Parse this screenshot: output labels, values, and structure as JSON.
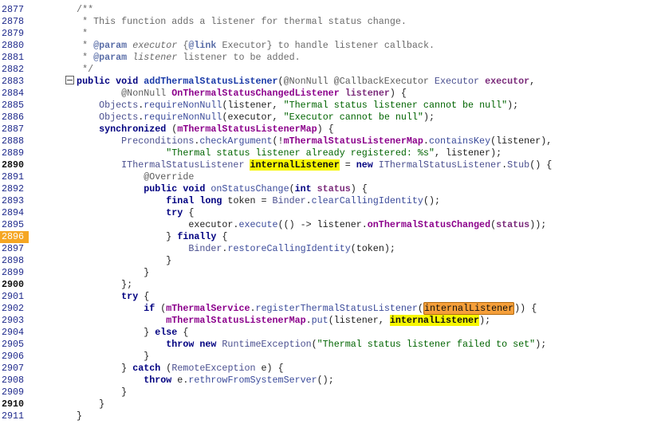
{
  "editor": {
    "highlighted_line": 2896,
    "lines": [
      {
        "num": "2877",
        "tokens": [
          {
            "t": "cm",
            "v": "    /**"
          }
        ]
      },
      {
        "num": "2878",
        "tokens": [
          {
            "t": "cm",
            "v": "     * This function adds a listener for thermal status change."
          }
        ]
      },
      {
        "num": "2879",
        "tokens": [
          {
            "t": "cm",
            "v": "     *"
          }
        ]
      },
      {
        "num": "2880",
        "tokens": [
          {
            "t": "cm",
            "v": "     * "
          },
          {
            "t": "ct",
            "v": "@param"
          },
          {
            "t": "cm",
            "v": " "
          },
          {
            "t": "ci",
            "v": "executor"
          },
          {
            "t": "cm",
            "v": " {"
          },
          {
            "t": "ct",
            "v": "@link"
          },
          {
            "t": "cm",
            "v": " Executor} to handle listener callback."
          }
        ]
      },
      {
        "num": "2881",
        "tokens": [
          {
            "t": "cm",
            "v": "     * "
          },
          {
            "t": "ct",
            "v": "@param"
          },
          {
            "t": "cm",
            "v": " "
          },
          {
            "t": "ci",
            "v": "listener"
          },
          {
            "t": "cm",
            "v": " listener to be added."
          }
        ]
      },
      {
        "num": "2882",
        "tokens": [
          {
            "t": "cm",
            "v": "     */"
          }
        ]
      },
      {
        "num": "2883",
        "tokens": [
          {
            "t": "kw",
            "v": "    public void "
          },
          {
            "t": "fn",
            "v": "addThermalStatusListener"
          },
          {
            "t": "pl",
            "v": "("
          },
          {
            "t": "an",
            "v": "@NonNull @CallbackExecutor"
          },
          {
            "t": "ty",
            "v": " Executor "
          },
          {
            "t": "pm",
            "v": "executor"
          },
          {
            "t": "pl",
            "v": ","
          }
        ]
      },
      {
        "num": "2884",
        "tokens": [
          {
            "t": "an",
            "v": "            @NonNull "
          },
          {
            "t": "fd",
            "v": "OnThermalStatusChangedListener"
          },
          {
            "t": "pl",
            "v": " "
          },
          {
            "t": "pm",
            "v": "listener"
          },
          {
            "t": "pl",
            "v": ") {"
          }
        ]
      },
      {
        "num": "2885",
        "tokens": [
          {
            "t": "ty",
            "v": "        Objects"
          },
          {
            "t": "pl",
            "v": "."
          },
          {
            "t": "mc",
            "v": "requireNonNull"
          },
          {
            "t": "pl",
            "v": "(listener, "
          },
          {
            "t": "st",
            "v": "\"Thermal status listener cannot be null\""
          },
          {
            "t": "pl",
            "v": ");"
          }
        ]
      },
      {
        "num": "2886",
        "tokens": [
          {
            "t": "ty",
            "v": "        Objects"
          },
          {
            "t": "pl",
            "v": "."
          },
          {
            "t": "mc",
            "v": "requireNonNull"
          },
          {
            "t": "pl",
            "v": "(executor, "
          },
          {
            "t": "st",
            "v": "\"Executor cannot be null\""
          },
          {
            "t": "pl",
            "v": ");"
          }
        ]
      },
      {
        "num": "2887",
        "tokens": [
          {
            "t": "kw",
            "v": "        synchronized"
          },
          {
            "t": "pl",
            "v": " ("
          },
          {
            "t": "fd",
            "v": "mThermalStatusListenerMap"
          },
          {
            "t": "pl",
            "v": ") {"
          }
        ]
      },
      {
        "num": "2888",
        "tokens": [
          {
            "t": "ty",
            "v": "            Preconditions"
          },
          {
            "t": "pl",
            "v": "."
          },
          {
            "t": "mc",
            "v": "checkArgument"
          },
          {
            "t": "pl",
            "v": "(!"
          },
          {
            "t": "fd",
            "v": "mThermalStatusListenerMap"
          },
          {
            "t": "pl",
            "v": "."
          },
          {
            "t": "mc",
            "v": "containsKey"
          },
          {
            "t": "pl",
            "v": "(listener),"
          }
        ]
      },
      {
        "num": "2889",
        "tokens": [
          {
            "t": "st",
            "v": "                    \"Thermal status listener already registered: %s\""
          },
          {
            "t": "pl",
            "v": ", listener);"
          }
        ]
      },
      {
        "num": "2890",
        "tokens": [
          {
            "t": "ty",
            "v": "            IThermalStatusListener "
          },
          {
            "t": "hy",
            "v": "internalListener"
          },
          {
            "t": "pl",
            "v": " = "
          },
          {
            "t": "kw",
            "v": "new"
          },
          {
            "t": "ty",
            "v": " IThermalStatusListener"
          },
          {
            "t": "pl",
            "v": "."
          },
          {
            "t": "ty",
            "v": "Stub"
          },
          {
            "t": "pl",
            "v": "() {"
          }
        ]
      },
      {
        "num": "2891",
        "tokens": [
          {
            "t": "an",
            "v": "                @Override"
          }
        ]
      },
      {
        "num": "2892",
        "tokens": [
          {
            "t": "kw",
            "v": "                public void "
          },
          {
            "t": "mc",
            "v": "onStatusChange"
          },
          {
            "t": "pl",
            "v": "("
          },
          {
            "t": "kw",
            "v": "int"
          },
          {
            "t": "pl",
            "v": " "
          },
          {
            "t": "pm",
            "v": "status"
          },
          {
            "t": "pl",
            "v": ") {"
          }
        ]
      },
      {
        "num": "2893",
        "tokens": [
          {
            "t": "kw",
            "v": "                    final long"
          },
          {
            "t": "pl",
            "v": " token = "
          },
          {
            "t": "ty",
            "v": "Binder"
          },
          {
            "t": "pl",
            "v": "."
          },
          {
            "t": "mc",
            "v": "clearCallingIdentity"
          },
          {
            "t": "pl",
            "v": "();"
          }
        ]
      },
      {
        "num": "2894",
        "tokens": [
          {
            "t": "kw",
            "v": "                    try"
          },
          {
            "t": "pl",
            "v": " {"
          }
        ]
      },
      {
        "num": "2895",
        "tokens": [
          {
            "t": "pl",
            "v": "                        executor."
          },
          {
            "t": "mc",
            "v": "execute"
          },
          {
            "t": "pl",
            "v": "(() -> listener."
          },
          {
            "t": "fd",
            "v": "onThermalStatusChanged"
          },
          {
            "t": "pl",
            "v": "("
          },
          {
            "t": "pm",
            "v": "status"
          },
          {
            "t": "pl",
            "v": "));"
          }
        ]
      },
      {
        "num": "2896",
        "tokens": [
          {
            "t": "pl",
            "v": "                    } "
          },
          {
            "t": "kw",
            "v": "finally"
          },
          {
            "t": "pl",
            "v": " {"
          }
        ]
      },
      {
        "num": "2897",
        "tokens": [
          {
            "t": "ty",
            "v": "                        Binder"
          },
          {
            "t": "pl",
            "v": "."
          },
          {
            "t": "mc",
            "v": "restoreCallingIdentity"
          },
          {
            "t": "pl",
            "v": "(token);"
          }
        ]
      },
      {
        "num": "2898",
        "tokens": [
          {
            "t": "pl",
            "v": "                    }"
          }
        ]
      },
      {
        "num": "2899",
        "tokens": [
          {
            "t": "pl",
            "v": "                }"
          }
        ]
      },
      {
        "num": "2900",
        "tokens": [
          {
            "t": "pl",
            "v": "            };"
          }
        ]
      },
      {
        "num": "2901",
        "tokens": [
          {
            "t": "kw",
            "v": "            try"
          },
          {
            "t": "pl",
            "v": " {"
          }
        ]
      },
      {
        "num": "2902",
        "tokens": [
          {
            "t": "kw",
            "v": "                if"
          },
          {
            "t": "pl",
            "v": " ("
          },
          {
            "t": "fd",
            "v": "mThermalService"
          },
          {
            "t": "pl",
            "v": "."
          },
          {
            "t": "mc",
            "v": "registerThermalStatusListener"
          },
          {
            "t": "pl",
            "v": "("
          },
          {
            "t": "ho",
            "v": "internalListener"
          },
          {
            "t": "pl",
            "v": ")) {"
          }
        ]
      },
      {
        "num": "2903",
        "tokens": [
          {
            "t": "fd",
            "v": "                    mThermalStatusListenerMap"
          },
          {
            "t": "pl",
            "v": "."
          },
          {
            "t": "mc",
            "v": "put"
          },
          {
            "t": "pl",
            "v": "(listener, "
          },
          {
            "t": "hy",
            "v": "internalListener"
          },
          {
            "t": "pl",
            "v": ");"
          }
        ]
      },
      {
        "num": "2904",
        "tokens": [
          {
            "t": "pl",
            "v": "                } "
          },
          {
            "t": "kw",
            "v": "else"
          },
          {
            "t": "pl",
            "v": " {"
          }
        ]
      },
      {
        "num": "2905",
        "tokens": [
          {
            "t": "kw",
            "v": "                    throw new"
          },
          {
            "t": "pl",
            "v": " "
          },
          {
            "t": "ty",
            "v": "RuntimeException"
          },
          {
            "t": "pl",
            "v": "("
          },
          {
            "t": "st",
            "v": "\"Thermal status listener failed to set\""
          },
          {
            "t": "pl",
            "v": ");"
          }
        ]
      },
      {
        "num": "2906",
        "tokens": [
          {
            "t": "pl",
            "v": "                }"
          }
        ]
      },
      {
        "num": "2907",
        "tokens": [
          {
            "t": "pl",
            "v": "            } "
          },
          {
            "t": "kw",
            "v": "catch"
          },
          {
            "t": "pl",
            "v": " ("
          },
          {
            "t": "ty",
            "v": "RemoteException"
          },
          {
            "t": "pl",
            "v": " e) {"
          }
        ]
      },
      {
        "num": "2908",
        "tokens": [
          {
            "t": "kw",
            "v": "                throw"
          },
          {
            "t": "pl",
            "v": " e."
          },
          {
            "t": "mc",
            "v": "rethrowFromSystemServer"
          },
          {
            "t": "pl",
            "v": "();"
          }
        ]
      },
      {
        "num": "2909",
        "tokens": [
          {
            "t": "pl",
            "v": "            }"
          }
        ]
      },
      {
        "num": "2910",
        "tokens": [
          {
            "t": "pl",
            "v": "        }"
          }
        ]
      },
      {
        "num": "2911",
        "tokens": [
          {
            "t": "pl",
            "v": "    }"
          }
        ]
      }
    ]
  }
}
